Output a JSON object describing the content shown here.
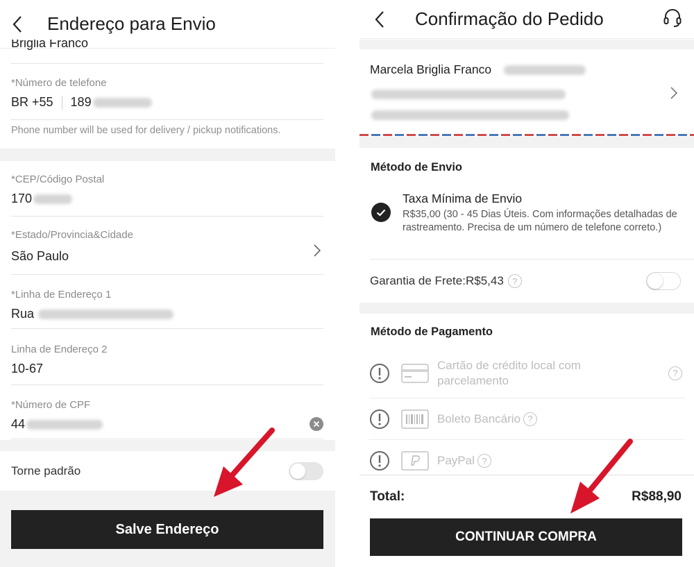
{
  "left": {
    "header_title": "Endereço para Envio",
    "top_partial_value": "Briglia Franco",
    "phone": {
      "label": "*Número de telefone",
      "country": "BR +55",
      "number_prefix": "189"
    },
    "phone_hint": "Phone number will be used for delivery / pickup notifications.",
    "cep": {
      "label": "*CEP/Código Postal",
      "value_prefix": "170"
    },
    "state": {
      "label": "*Estado/Provincia&Cidade",
      "value": "São Paulo"
    },
    "addr1": {
      "label": "*Linha de Endereço 1",
      "value_prefix": "Rua"
    },
    "addr2": {
      "label": "Linha de Endereço 2",
      "value": "10-67"
    },
    "cpf": {
      "label": "*Número de CPF",
      "value_prefix": "44"
    },
    "default_label": "Torne padrão",
    "save_label": "Salve Endereço"
  },
  "right": {
    "header_title": "Confirmação do Pedido",
    "recipient_name": "Marcela Briglia Franco",
    "shipping_title": "Método de Envio",
    "shipping_option_name": "Taxa Mínima de Envio",
    "shipping_option_desc": "R$35,00  (30 - 45 Dias Úteis. Com informações detalhadas de rastreamento. Precisa de um número de telefone correto.)",
    "guarantee_label": "Garantia de Frete:R$5,43",
    "payment_title": "Método de Pagamento",
    "payment_options": [
      {
        "label": "Cartão de crédito local com parcelamento"
      },
      {
        "label": "Boleto Bancário"
      },
      {
        "label": "PayPal"
      }
    ],
    "total_label": "Total:",
    "total_value": "R$88,90",
    "continue_label": "CONTINUAR COMPRA"
  },
  "colors": {
    "accent_arrow": "#d8152a",
    "button_bg": "#222222",
    "airmail_red": "#d04a4a",
    "airmail_blue": "#4a78b8"
  }
}
